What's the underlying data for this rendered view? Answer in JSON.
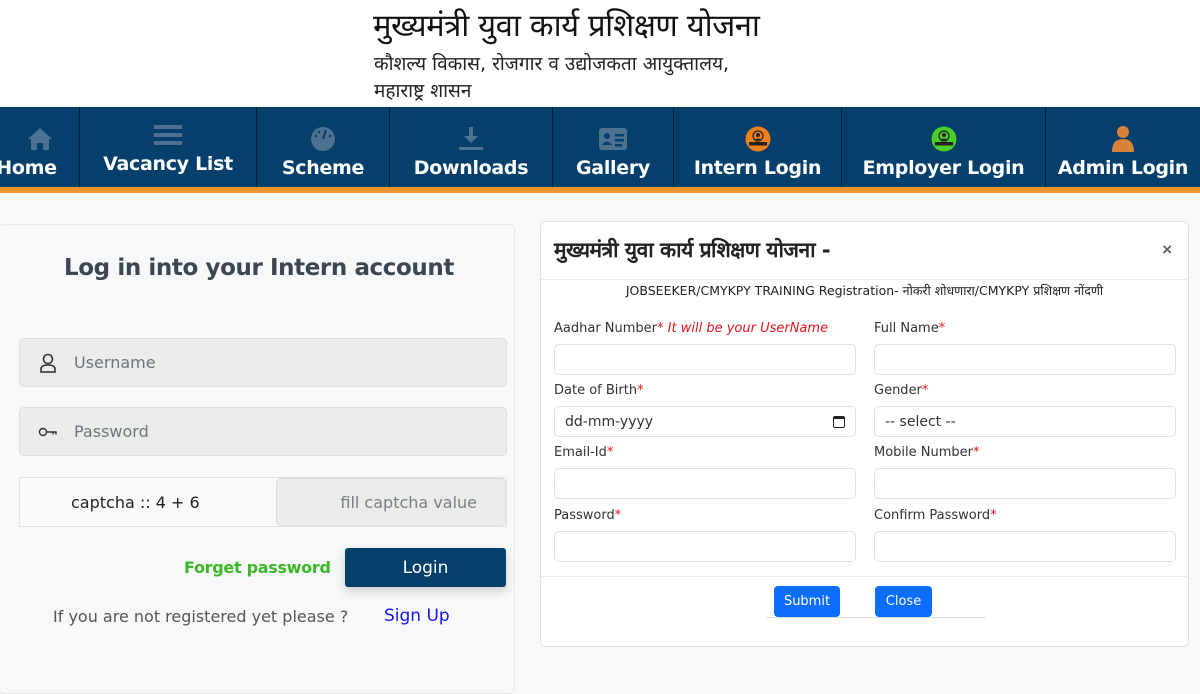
{
  "header": {
    "title": "मुख्यमंत्री युवा कार्य प्रशिक्षण योजना",
    "subtitle_line1": "कौशल्य विकास, रोजगार व उद्योजकता आयुक्तालय,",
    "subtitle_line2": "महाराष्ट्र शासन"
  },
  "nav": {
    "items": [
      {
        "label": "Home",
        "icon": "home-icon"
      },
      {
        "label": "Vacancy List",
        "icon": "list-icon"
      },
      {
        "label": "Scheme",
        "icon": "dashboard-icon"
      },
      {
        "label": "Downloads",
        "icon": "download-icon"
      },
      {
        "label": "Gallery",
        "icon": "id-card-icon"
      },
      {
        "label": "Intern Login",
        "icon": "intern-badge-icon"
      },
      {
        "label": "Employer Login",
        "icon": "employer-badge-icon"
      },
      {
        "label": "Admin Login",
        "icon": "user-icon"
      }
    ]
  },
  "login": {
    "title": "Log in into your Intern account",
    "username_placeholder": "Username",
    "password_placeholder": "Password",
    "captcha_label": "captcha :: 4 + 6",
    "captcha_placeholder": "fill captcha value",
    "forgot_label": "Forget password",
    "login_label": "Login",
    "not_registered_text": "If you are not registered yet please ?",
    "signup_label": "Sign Up"
  },
  "modal": {
    "title": "मुख्यमंत्री युवा कार्य प्रशिक्षण योजना -",
    "close_glyph": "×",
    "subtitle": "JOBSEEKER/CMYKPY TRAINING Registration- नोकरी शोधणारा/CMYKPY प्रशिक्षण नोंदणी",
    "required_mark": "*",
    "fields": {
      "aadhar": {
        "label": "Aadhar Number",
        "hint": "It will be your UserName",
        "value": ""
      },
      "full_name": {
        "label": "Full Name",
        "value": ""
      },
      "dob": {
        "label": "Date of Birth",
        "value": "dd-mm-yyyy"
      },
      "gender": {
        "label": "Gender",
        "value": "-- select --"
      },
      "email": {
        "label": "Email-Id",
        "value": ""
      },
      "mobile": {
        "label": "Mobile Number",
        "value": ""
      },
      "password": {
        "label": "Password",
        "value": ""
      },
      "confirm_password": {
        "label": "Confirm Password",
        "value": ""
      }
    },
    "submit_label": "Submit",
    "close_label": "Close"
  },
  "colors": {
    "nav_bg": "#053f6b",
    "nav_accent": "#f2922f",
    "login_button": "#053f6b",
    "forgot_green": "#3bb826",
    "signup_blue": "#1515e8",
    "primary_button": "#0d6efd",
    "required_red": "#e3151c"
  }
}
